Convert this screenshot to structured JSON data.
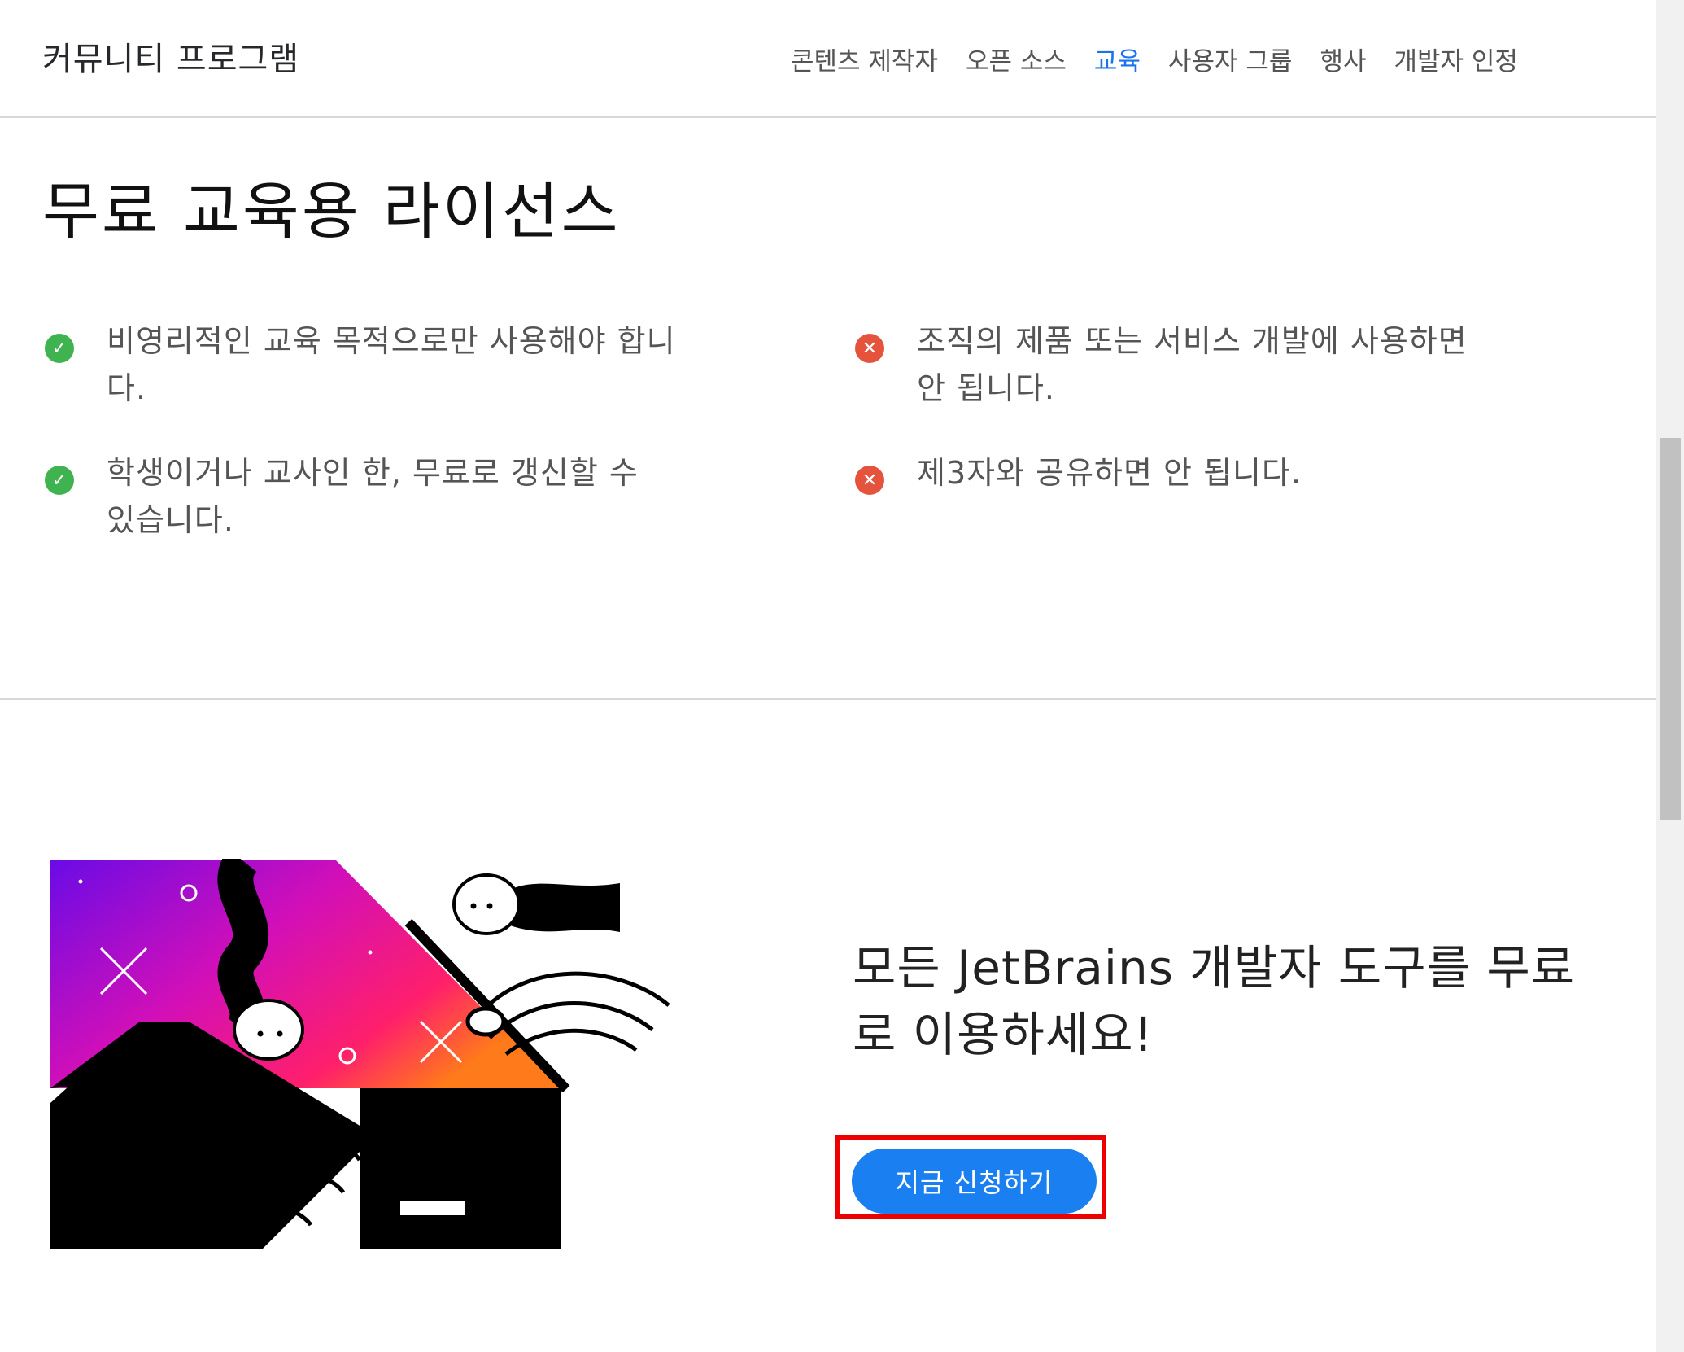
{
  "header": {
    "brand": "커뮤니티 프로그램",
    "nav": [
      "콘텐츠 제작자",
      "오픈 소스",
      "교육",
      "사용자 그룹",
      "행사",
      "개발자 인정"
    ],
    "active_nav": "교육"
  },
  "license": {
    "title": "무료 교육용 라이선스",
    "allowed": [
      "비영리적인 교육 목적으로만 사용해야 합니다.",
      "학생이거나 교사인 한, 무료로 갱신할 수 있습니다."
    ],
    "forbidden": [
      "조직의 제품 또는 서비스 개발에 사용하면 안 됩니다.",
      "제3자와 공유하면 안 됩니다."
    ]
  },
  "promo": {
    "title": "모든 JetBrains 개발자 도구를 무료로 이용하세요!",
    "cta_label": "지금 신청하기"
  },
  "colors": {
    "accent": "#1a7ff0",
    "nav_active": "#1a73e8",
    "check": "#3fb34f",
    "cross": "#e5533d",
    "highlight": "#ee0000"
  },
  "icons": {
    "allowed": "check-circle-icon",
    "forbidden": "x-circle-icon"
  }
}
